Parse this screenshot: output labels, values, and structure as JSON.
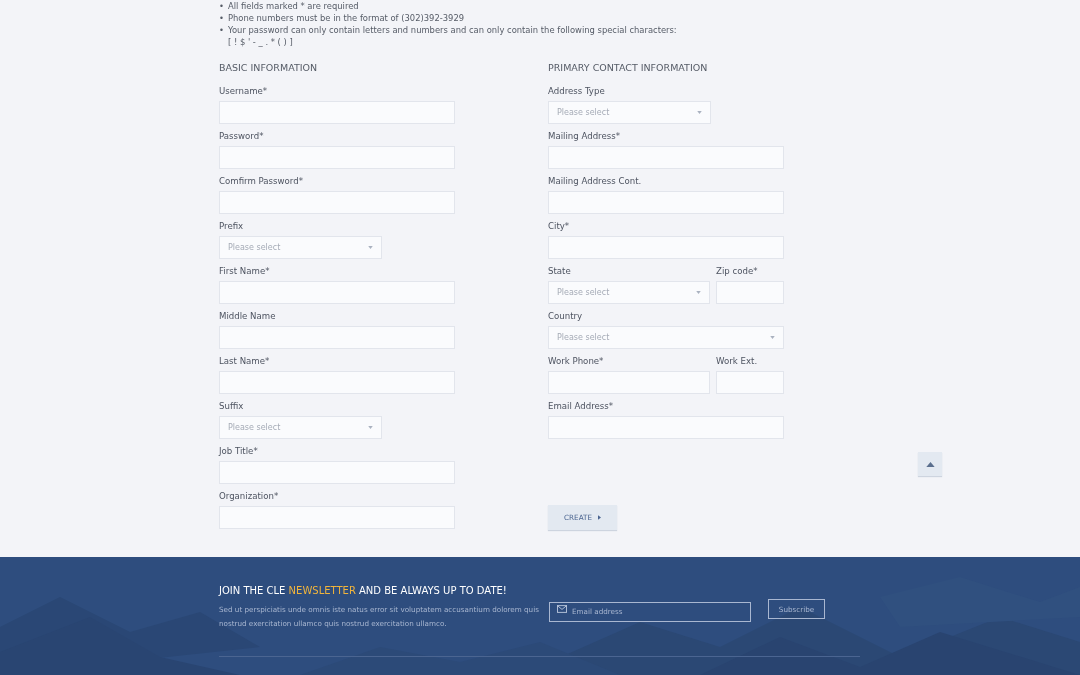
{
  "notes": [
    {
      "marker": "•",
      "text": "All fields marked * are required"
    },
    {
      "marker": "•",
      "text": "Phone numbers must be in the format of (302)392-3929"
    },
    {
      "marker": "•",
      "text": "Your password can only contain letters and numbers and can only contain the following special characters:\n[ ! $ ' - _ . * ( ) ]"
    }
  ],
  "sections": [
    {
      "title": "BASIC INFORMATION",
      "rows": [
        [
          {
            "label": "Username*",
            "kind": "text"
          }
        ],
        [
          {
            "label": "Password*",
            "kind": "text"
          }
        ],
        [
          {
            "label": "Comfirm Password*",
            "kind": "text"
          }
        ],
        [
          {
            "label": "Prefix",
            "kind": "miniselect",
            "placeholder": "Please select"
          }
        ],
        [
          {
            "label": "First Name*",
            "kind": "text"
          }
        ],
        [
          {
            "label": "Middle Name",
            "kind": "text"
          }
        ],
        [
          {
            "label": "Last Name*",
            "kind": "text"
          }
        ],
        [
          {
            "label": "Suffix",
            "kind": "miniselect",
            "placeholder": "Please select"
          }
        ],
        [
          {
            "label": "Job Title*",
            "kind": "text"
          }
        ],
        [
          {
            "label": "Organization*",
            "kind": "text"
          }
        ]
      ]
    },
    {
      "title": "PRIMARY CONTACT INFORMATION",
      "rows": [
        [
          {
            "label": "Address Type",
            "kind": "miniselect",
            "placeholder": "Please select"
          }
        ],
        [
          {
            "label": "Mailing Address*",
            "kind": "text"
          }
        ],
        [
          {
            "label": "Mailing Address Cont.",
            "kind": "text"
          }
        ],
        [
          {
            "label": "City*",
            "kind": "text"
          }
        ],
        [
          {
            "label": "State",
            "kind": "select",
            "placeholder": "Please select"
          },
          {
            "label": "Zip code*",
            "kind": "text"
          }
        ],
        [
          {
            "label": "Country",
            "kind": "select",
            "placeholder": "Please select"
          }
        ],
        [
          {
            "label": "Work Phone*",
            "kind": "text"
          },
          {
            "label": "Work Ext.",
            "kind": "text"
          }
        ],
        [
          {
            "label": "Email Address*",
            "kind": "text"
          }
        ]
      ],
      "button": "CREATE"
    }
  ],
  "footer": {
    "title_parts": [
      {
        "text": "JOIN THE CLE ",
        "highlight": false
      },
      {
        "text": "NEWSLETTER",
        "highlight": true
      },
      {
        "text": " AND BE ALWAYS UP TO DATE!",
        "highlight": false
      }
    ],
    "text": "Sed ut perspiciatis unde omnis iste natus error sit voluptatem accusantium dolorem  quis nostrud exercitation ullamco  quis nostrud exercitation ullamco.",
    "email_placeholder": "Email address",
    "subscribe": "Subscribe"
  }
}
